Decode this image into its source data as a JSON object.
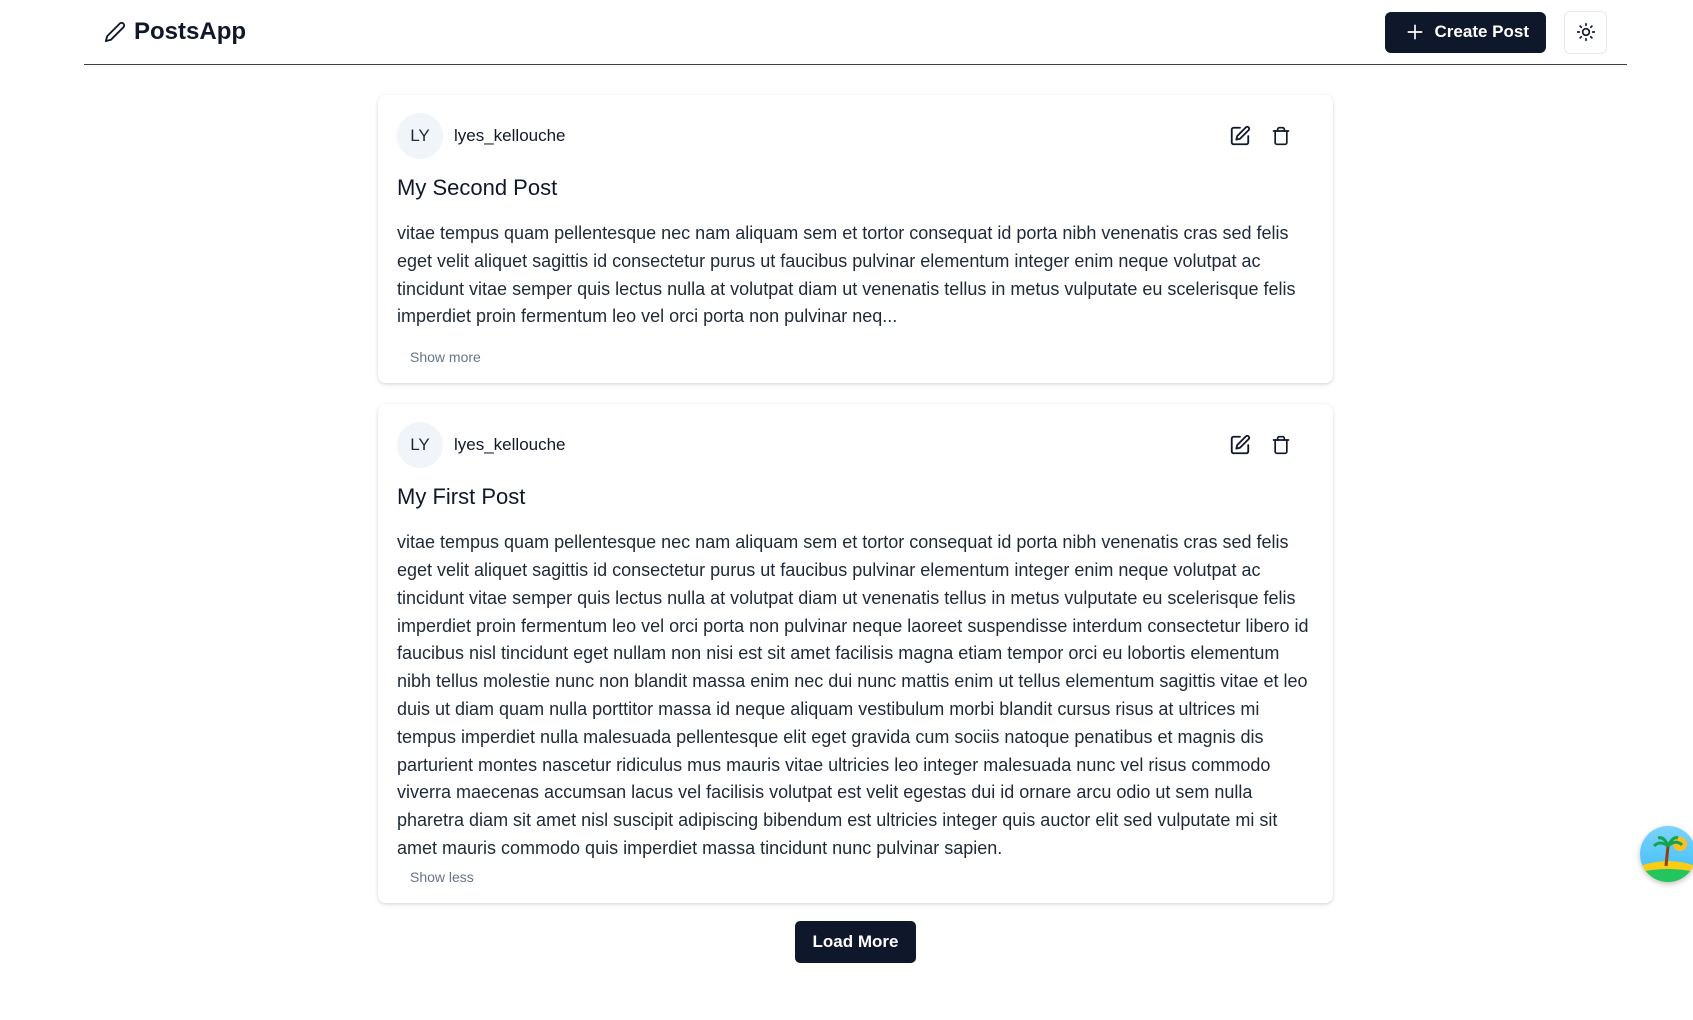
{
  "header": {
    "app_name": "PostsApp",
    "create_label": "Create Post"
  },
  "posts": [
    {
      "avatar_initials": "LY",
      "username": "lyes_kellouche",
      "title": "My Second Post",
      "body": "vitae tempus quam pellentesque nec nam aliquam sem et tortor consequat id porta nibh venenatis cras sed felis eget velit aliquet sagittis id consectetur purus ut faucibus pulvinar elementum integer enim neque volutpat ac tincidunt vitae semper quis lectus nulla at volutpat diam ut venenatis tellus in metus vulputate eu scelerisque felis imperdiet proin fermentum leo vel orci porta non pulvinar neq...",
      "toggle_label": "Show more"
    },
    {
      "avatar_initials": "LY",
      "username": "lyes_kellouche",
      "title": "My First Post",
      "body": "vitae tempus quam pellentesque nec nam aliquam sem et tortor consequat id porta nibh venenatis cras sed felis eget velit aliquet sagittis id consectetur purus ut faucibus pulvinar elementum integer enim neque volutpat ac tincidunt vitae semper quis lectus nulla at volutpat diam ut venenatis tellus in metus vulputate eu scelerisque felis imperdiet proin fermentum leo vel orci porta non pulvinar neque laoreet suspendisse interdum consectetur libero id faucibus nisl tincidunt eget nullam non nisi est sit amet facilisis magna etiam tempor orci eu lobortis elementum nibh tellus molestie nunc non blandit massa enim nec dui nunc mattis enim ut tellus elementum sagittis vitae et leo duis ut diam quam nulla porttitor massa id neque aliquam vestibulum morbi blandit cursus risus at ultrices mi tempus imperdiet nulla malesuada pellentesque elit eget gravida cum sociis natoque penatibus et magnis dis parturient montes nascetur ridiculus mus mauris vitae ultricies leo integer malesuada nunc vel risus commodo viverra maecenas accumsan lacus vel facilisis volutpat est velit egestas dui id ornare arcu odio ut sem nulla pharetra diam sit amet nisl suscipit adipiscing bibendum est ultricies integer quis auctor elit sed vulputate mi sit amet mauris commodo quis imperdiet massa tincidunt nunc pulvinar sapien.",
      "toggle_label": "Show less"
    }
  ],
  "load_more_label": "Load More",
  "icons": {
    "brand": "pencil-icon",
    "create": "plus-icon",
    "theme": "sun-icon",
    "edit": "edit-icon",
    "delete": "trash-icon",
    "floating": "island-avatar-icon"
  },
  "colors": {
    "primary": "#0f172a",
    "muted_text": "#64748b",
    "avatar_bg": "#f1f5f9"
  }
}
